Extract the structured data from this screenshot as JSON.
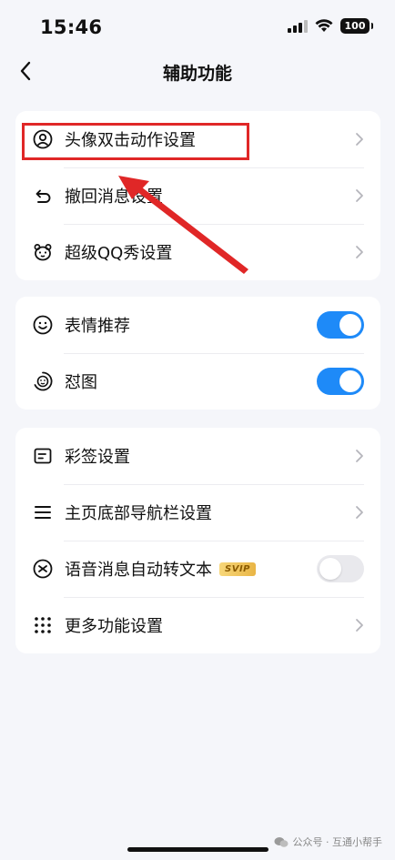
{
  "status_bar": {
    "time": "15:46",
    "battery": "100"
  },
  "nav": {
    "title": "辅助功能"
  },
  "groups": [
    {
      "items": [
        {
          "label": "头像双击动作设置",
          "icon": "avatar-circle-icon",
          "control": "chevron"
        },
        {
          "label": "撤回消息设置",
          "icon": "undo-icon",
          "control": "chevron"
        },
        {
          "label": "超级QQ秀设置",
          "icon": "qq-show-bear-icon",
          "control": "chevron"
        }
      ]
    },
    {
      "items": [
        {
          "label": "表情推荐",
          "icon": "smile-icon",
          "control": "toggle",
          "on": true
        },
        {
          "label": "怼图",
          "icon": "swirl-face-icon",
          "control": "toggle",
          "on": true
        }
      ]
    },
    {
      "items": [
        {
          "label": "彩签设置",
          "icon": "tag-card-icon",
          "control": "chevron"
        },
        {
          "label": "主页底部导航栏设置",
          "icon": "list-lines-icon",
          "control": "chevron"
        },
        {
          "label": "语音消息自动转文本",
          "badge": "SVIP",
          "icon": "voice-to-text-icon",
          "control": "toggle",
          "on": false
        },
        {
          "label": "更多功能设置",
          "icon": "grid-dots-icon",
          "control": "chevron"
        }
      ]
    }
  ],
  "annotation": {
    "color": "#e02727"
  },
  "colors": {
    "toggle_on": "#1e8af8",
    "toggle_off": "#e9e9ed",
    "background": "#f5f6fa"
  },
  "watermark": {
    "text": "公众号 · 互通小帮手"
  }
}
